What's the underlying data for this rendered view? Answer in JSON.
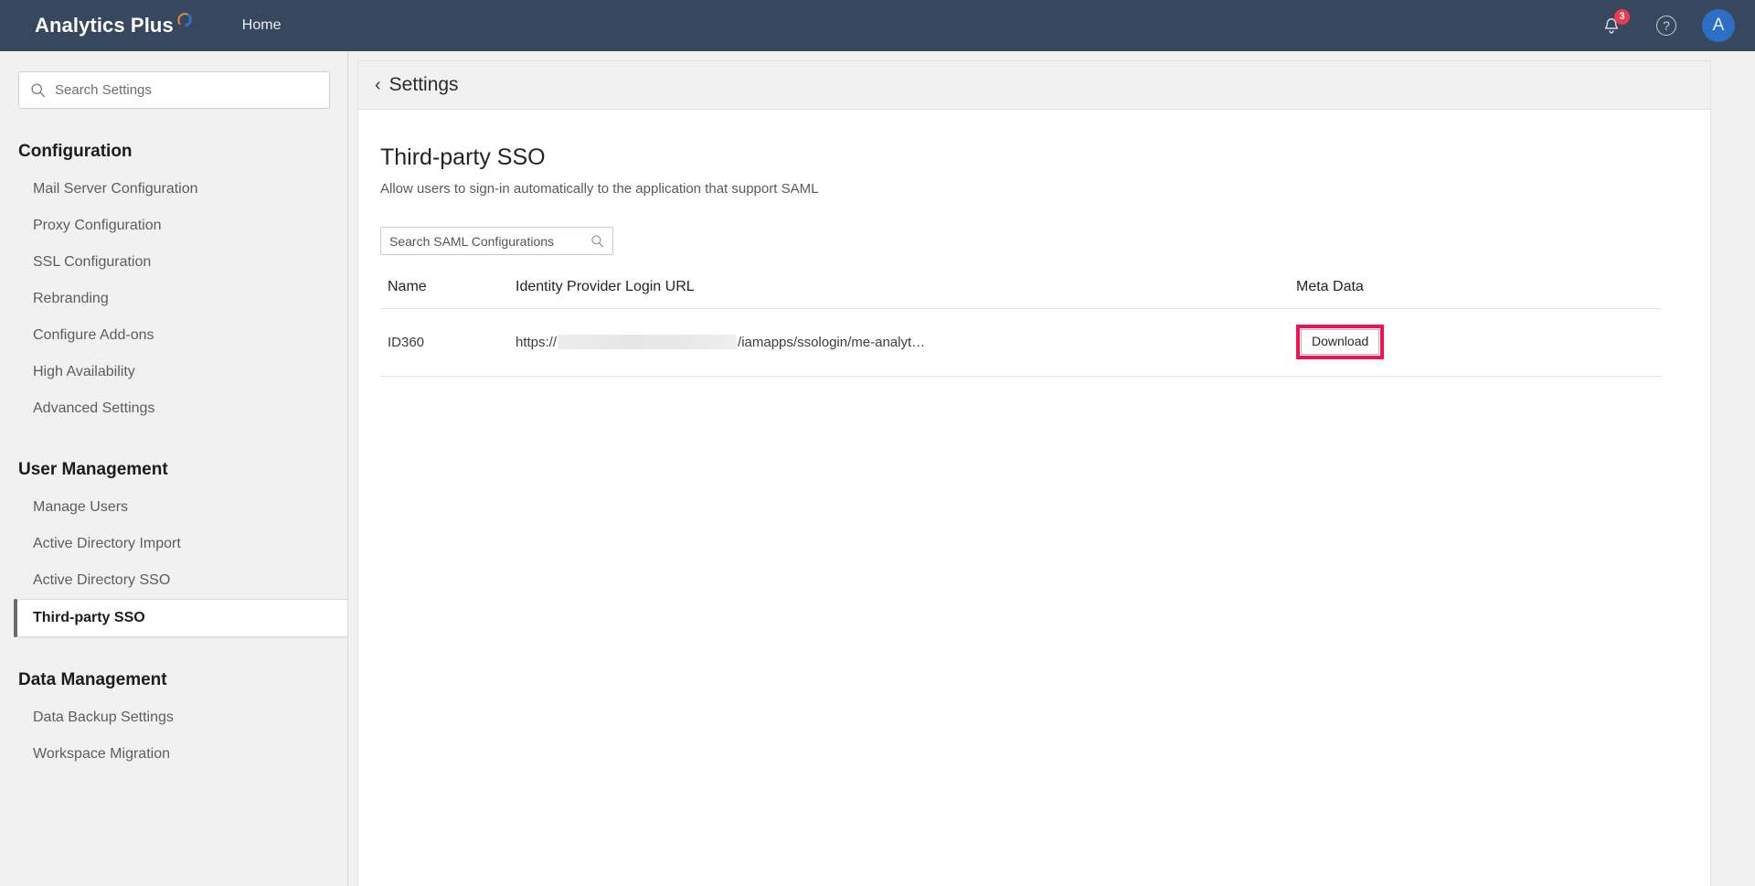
{
  "header": {
    "brand": "Analytics Plus",
    "brand_mark_icon": "arc-swoosh-icon",
    "nav": {
      "home": "Home"
    },
    "notifications": {
      "icon": "bell-icon",
      "count": "3"
    },
    "help": {
      "icon": "help-circle-icon",
      "glyph": "?"
    },
    "avatar": {
      "initial": "A"
    },
    "bar_color": "#37485e",
    "badge_color": "#ea3a4b",
    "avatar_color": "#2c6fc4"
  },
  "sidebar": {
    "search": {
      "placeholder": "Search Settings",
      "value": "",
      "icon": "search-icon"
    },
    "sections": [
      {
        "title": "Configuration",
        "items": [
          {
            "label": "Mail Server Configuration",
            "active": false
          },
          {
            "label": "Proxy Configuration",
            "active": false
          },
          {
            "label": "SSL Configuration",
            "active": false
          },
          {
            "label": "Rebranding",
            "active": false
          },
          {
            "label": "Configure Add-ons",
            "active": false
          },
          {
            "label": "High Availability",
            "active": false
          },
          {
            "label": "Advanced Settings",
            "active": false
          }
        ]
      },
      {
        "title": "User Management",
        "items": [
          {
            "label": "Manage Users",
            "active": false
          },
          {
            "label": "Active Directory Import",
            "active": false
          },
          {
            "label": "Active Directory SSO",
            "active": false
          },
          {
            "label": "Third-party SSO",
            "active": true
          }
        ]
      },
      {
        "title": "Data Management",
        "items": [
          {
            "label": "Data Backup Settings",
            "active": false
          },
          {
            "label": "Workspace Migration",
            "active": false
          }
        ]
      }
    ]
  },
  "main": {
    "breadcrumb": {
      "label": "Settings",
      "back_icon": "chevron-left-icon"
    },
    "page_title": "Third-party SSO",
    "page_description": "Allow users to sign-in automatically to the application that support SAML",
    "search": {
      "placeholder": "Search SAML Configurations",
      "value": "",
      "icon": "search-icon"
    },
    "table": {
      "columns": [
        "Name",
        "Identity Provider Login URL",
        "Meta Data"
      ],
      "rows": [
        {
          "name": "ID360",
          "url_prefix": "https://",
          "url_redacted": true,
          "url_suffix": "/iamapps/ssologin/me-analyt…",
          "meta_action": "Download",
          "meta_highlighted": true
        }
      ]
    },
    "highlight_color": "#f5104e"
  }
}
